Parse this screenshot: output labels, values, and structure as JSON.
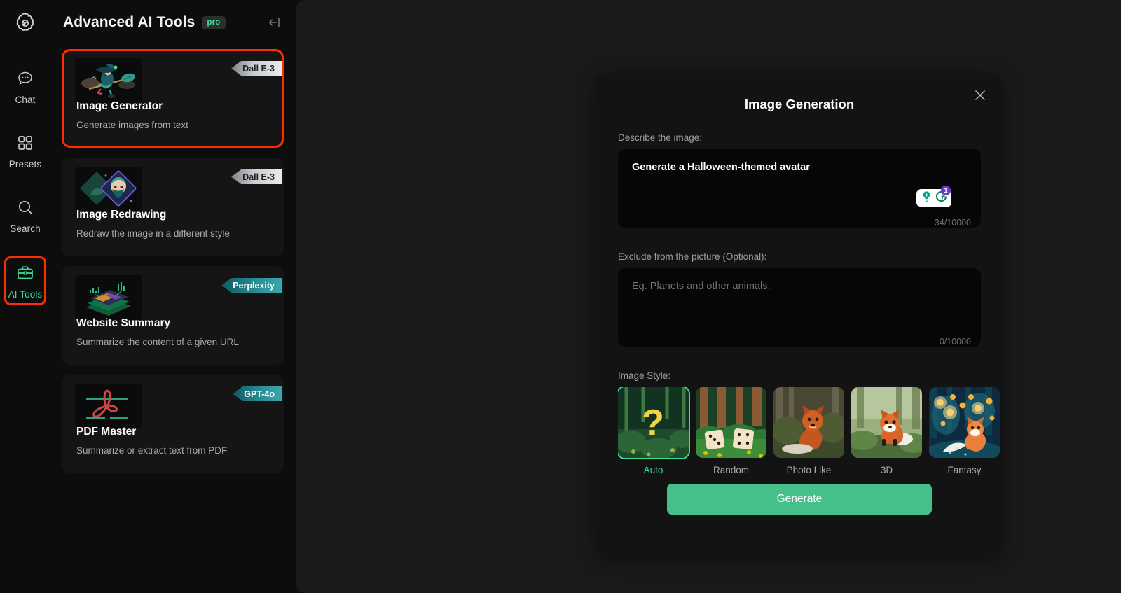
{
  "rail": {
    "logo_icon": "atom-flower-logo",
    "items": [
      {
        "label": "Chat",
        "icon": "chat-bubble-icon",
        "active": false,
        "highlight": false
      },
      {
        "label": "Presets",
        "icon": "grid-squares-icon",
        "active": false,
        "highlight": false
      },
      {
        "label": "Search",
        "icon": "magnifier-icon",
        "active": false,
        "highlight": false
      },
      {
        "label": "AI Tools",
        "icon": "briefcase-icon",
        "active": true,
        "highlight": true
      }
    ]
  },
  "panel": {
    "title": "Advanced AI Tools",
    "pro_badge": "pro",
    "collapse_icon": "collapse-left-icon",
    "cards": [
      {
        "title": "Image Generator",
        "desc": "Generate images from text",
        "badge": "Dall E-3",
        "badge_style": "silver",
        "thumb_icon": "witch-on-broom-illustration",
        "selected": true
      },
      {
        "title": "Image Redrawing",
        "desc": "Redraw the image in a different style",
        "badge": "Dall E-3",
        "badge_style": "silver",
        "thumb_icon": "portrait-diamond-illustration",
        "selected": false
      },
      {
        "title": "Website Summary",
        "desc": "Summarize the content of a given URL",
        "badge": "Perplexity",
        "badge_style": "teal",
        "thumb_icon": "data-layers-chart-illustration",
        "selected": false
      },
      {
        "title": "PDF Master",
        "desc": "Summarize or extract text from PDF",
        "badge": "GPT-4o",
        "badge_style": "teal",
        "thumb_icon": "pdf-acrobat-illustration",
        "selected": false
      }
    ]
  },
  "modal": {
    "title": "Image Generation",
    "close_icon": "close-icon",
    "describe": {
      "label": "Describe the image:",
      "value": "Generate a Halloween-themed avatar",
      "placeholder": "",
      "counter": "34/10000",
      "grammarly": {
        "badge": "1",
        "bulb_icon": "lightbulb-icon",
        "g_icon": "grammarly-g-icon"
      }
    },
    "exclude": {
      "label": "Exclude from the picture (Optional):",
      "value": "",
      "placeholder": "Eg. Planets and other animals.",
      "counter": "0/10000"
    },
    "style": {
      "label": "Image Style:",
      "options": [
        {
          "name": "Auto",
          "selected": true,
          "thumb": "question-mark-forest"
        },
        {
          "name": "Random",
          "selected": false,
          "thumb": "dice-forest"
        },
        {
          "name": "Photo Like",
          "selected": false,
          "thumb": "photo-fox"
        },
        {
          "name": "3D",
          "selected": false,
          "thumb": "3d-fox"
        },
        {
          "name": "Fantasy",
          "selected": false,
          "thumb": "fantasy-fox"
        }
      ]
    },
    "generate_label": "Generate"
  },
  "colors": {
    "accent_green": "#3ddc97",
    "button_green": "#45c08b",
    "highlight_red": "#ff2d00",
    "panel_bg": "#0d0d0d",
    "main_bg": "#1a1a1a",
    "modal_bg": "#131313"
  },
  "cursor": {
    "icon": "arrow-pointer-red"
  }
}
